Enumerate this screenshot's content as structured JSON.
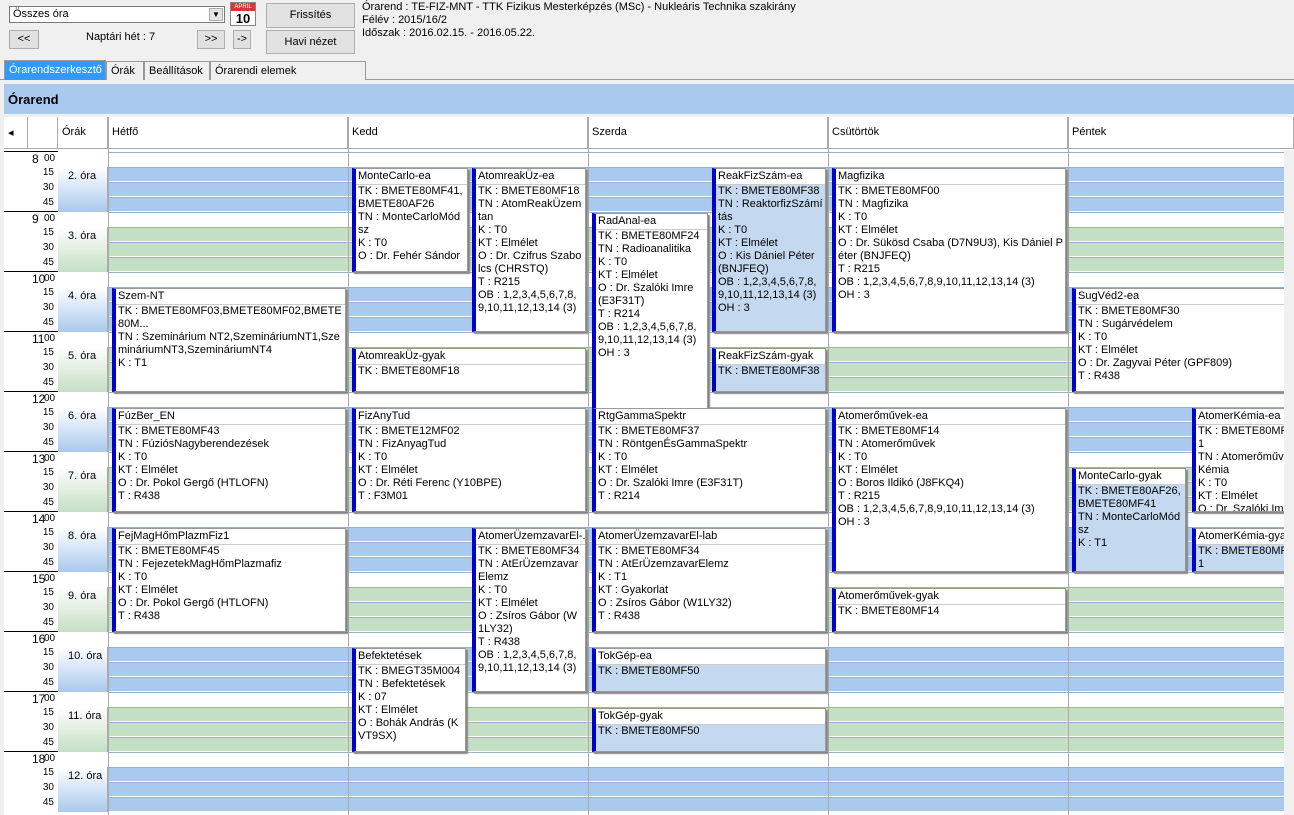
{
  "toolbar": {
    "combo_value": "Összes óra",
    "calendar_icon": "calendar-icon",
    "calendar_month": "APRIL",
    "calendar_day": "10",
    "prev_label": "<<",
    "next_label": ">>",
    "jump_label": "->",
    "week_label": "Naptári hét : 7",
    "refresh_label": "Frissítés",
    "monthly_label": "Havi nézet"
  },
  "info": {
    "line1": "Órarend : TE-FIZ-MNT - TTK Fizikus Mesterképzés (MSc) - Nukleáris Technika szakirány",
    "line2": "Félév : 2015/16/2",
    "line3": "Időszak : 2016.02.15. - 2016.05.22."
  },
  "tabs": [
    "Órarendszerkesztő",
    "Órák",
    "Beállítások",
    "Órarendi elemek szinbeállítása"
  ],
  "title": "Órarend",
  "headers": {
    "arrow": "◂",
    "orak": "Órák",
    "days": [
      "Hétfő",
      "Kedd",
      "Szerda",
      "Csütörtök",
      "Péntek"
    ]
  },
  "hours": [
    "8",
    "9",
    "10",
    "11",
    "12",
    "13",
    "14",
    "15",
    "16",
    "17",
    "18"
  ],
  "minute_label": "00",
  "minutes": [
    "15",
    "30",
    "45"
  ],
  "periods": [
    "2. óra",
    "3. óra",
    "4. óra",
    "5. óra",
    "6. óra",
    "7. óra",
    "8. óra",
    "9. óra",
    "10. óra",
    "11. óra",
    "12. óra"
  ],
  "colors": {
    "blue_band": "#a9c9ee",
    "green_band": "#c5dfc5",
    "accent": "#0000cc"
  },
  "events": [
    {
      "title": "MonteCarlo-ea",
      "lines": [
        "TK : BMETE80MF41,BMETE80AF26",
        "TN : MonteCarloMódsz",
        "K : T0",
        "O : Dr. Fehér Sándor"
      ]
    },
    {
      "title": "AtomreakÜz-ea",
      "lines": [
        "TK : BMETE80MF18",
        "TN : AtomReakÜzemtan",
        "K : T0",
        "KT : Elmélet",
        "O : Dr. Czifrus Szabolcs (CHRSTQ)",
        "T : R215",
        "OB : 1,2,3,4,5,6,7,8,9,10,11,12,13,14 (3)"
      ]
    },
    {
      "title": "ReakFizSzám-ea",
      "lines": [
        "TK : BMETE80MF38",
        "TN : ReaktorfizSzámítás",
        "K : T0",
        "KT : Elmélet",
        "O : Kis Dániel Péter (BNJFEQ)",
        "OB : 1,2,3,4,5,6,7,8,9,10,11,12,13,14 (3)",
        "OH : 3"
      ]
    },
    {
      "title": "Magfizika",
      "lines": [
        "TK : BMETE80MF00",
        "TN : Magfizika",
        "K : T0",
        "KT : Elmélet",
        "O : Dr. Sükösd Csaba (D7N9U3), Kis Dániel Péter (BNJFEQ)",
        "T : R215",
        "OB : 1,2,3,4,5,6,7,8,9,10,11,12,13,14 (3)",
        "OH : 3"
      ]
    },
    {
      "title": "RadAnal-ea",
      "lines": [
        "TK : BMETE80MF24",
        "TN : Radioanalitika",
        "K : T0",
        "KT : Elmélet",
        "O : Dr. Szalóki Imre (E3F31T)",
        "T : R214",
        "OB : 1,2,3,4,5,6,7,8,9,10,11,12,13,14 (3)",
        "OH : 3"
      ]
    },
    {
      "title": "Szem-NT",
      "lines": [
        "TK : BMETE80MF03,BMETE80MF02,BMETE80M...",
        "TN : Szeminárium NT2,SzemináriumNT1,SzemináriumNT3,SzemináriumNT4",
        "K : T1"
      ]
    },
    {
      "title": "SugVéd2-ea",
      "lines": [
        "TK : BMETE80MF30",
        "TN : Sugárvédelem",
        "K : T0",
        "KT : Elmélet",
        "O : Dr. Zagyvai Péter (GPF809)",
        "T : R438"
      ]
    },
    {
      "title": "AtomreakÜz-gyak",
      "lines": [
        "TK : BMETE80MF18"
      ]
    },
    {
      "title": "ReakFizSzám-gyak",
      "lines": [
        "TK : BMETE80MF38"
      ]
    },
    {
      "title": "FúzBer_EN",
      "lines": [
        "TK : BMETE80MF43",
        "TN : FúziósNagyberendezések",
        "K : T0",
        "KT : Elmélet",
        "O : Dr. Pokol Gergő (HTLOFN)",
        "T : R438"
      ]
    },
    {
      "title": "FizAnyTud",
      "lines": [
        "TK : BMETE12MF02",
        "TN : FizAnyagTud",
        "K : T0",
        "KT : Elmélet",
        "O : Dr. Réti Ferenc (Y10BPE)",
        "T : F3M01"
      ]
    },
    {
      "title": "RtgGammaSpektr",
      "lines": [
        "TK : BMETE80MF37",
        "TN : RöntgenÉsGammaSpektr",
        "K : T0",
        "KT : Elmélet",
        "O : Dr. Szalóki Imre (E3F31T)",
        "T : R214"
      ]
    },
    {
      "title": "Atomerőművek-ea",
      "lines": [
        "TK : BMETE80MF14",
        "TN : Atomerőművek",
        "K : T0",
        "KT : Elmélet",
        "O : Boros Ildikó (J8FKQ4)",
        "T : R215",
        "OB : 1,2,3,4,5,6,7,8,9,10,11,12,13,14 (3)",
        "OH : 3"
      ]
    },
    {
      "title": "AtomerKémia-ea",
      "lines": [
        "TK : BMETE80MF1",
        "TN : AtomerőműviKémia",
        "K : T0",
        "KT : Elmélet",
        "O : Dr. Szalóki Imre"
      ]
    },
    {
      "title": "MonteCarlo-gyak",
      "lines": [
        "TK : BMETE80AF26,BMETE80MF41",
        "TN : MonteCarloMódsz",
        "K : T1"
      ]
    },
    {
      "title": "FejMagHőmPlazmFiz1",
      "lines": [
        "TK : BMETE80MF45",
        "TN : FejezetekMagHőmPlazmafiz",
        "K : T0",
        "KT : Elmélet",
        "O : Dr. Pokol Gergő (HTLOFN)",
        "T : R438"
      ]
    },
    {
      "title": "AtomerÜzemzavarEl-...",
      "lines": [
        "TK : BMETE80MF34",
        "TN : AtErÜzemzavarElemz",
        "K : T0",
        "KT : Elmélet",
        "O : Zsíros Gábor (W1LY32)",
        "T : R438",
        "OB : 1,2,3,4,5,6,7,8,9,10,11,12,13,14 (3)"
      ]
    },
    {
      "title": "AtomerÜzemzavarEl-lab",
      "lines": [
        "TK : BMETE80MF34",
        "TN : AtErÜzemzavarElemz",
        "K : T1",
        "KT : Gyakorlat",
        "O : Zsíros Gábor (W1LY32)",
        "T : R438"
      ]
    },
    {
      "title": "AtomerKémia-gyak",
      "lines": [
        "TK : BMETE80MF1"
      ]
    },
    {
      "title": "Atomerőművek-gyak",
      "lines": [
        "TK : BMETE80MF14"
      ]
    },
    {
      "title": "Befektetések",
      "lines": [
        "TK : BMEGT35M004",
        "TN : Befektetések",
        "K : 07",
        "KT : Elmélet",
        "O : Bohák András (KVT9SX)"
      ]
    },
    {
      "title": "TokGép-ea",
      "lines": [
        "TK : BMETE80MF50"
      ]
    },
    {
      "title": "TokGép-gyak",
      "lines": [
        "TK : BMETE80MF50"
      ]
    }
  ]
}
